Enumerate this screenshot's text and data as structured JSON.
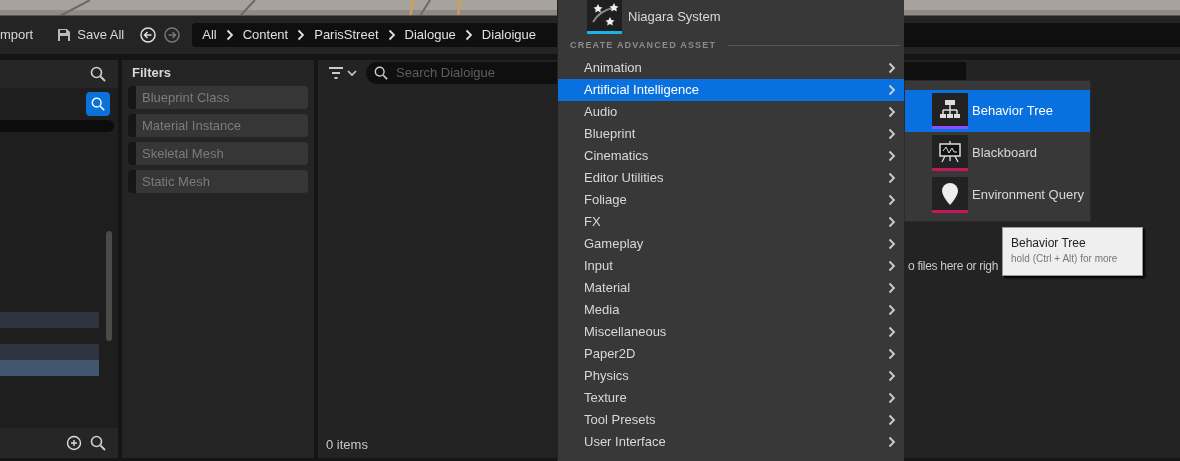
{
  "toolbar": {
    "import_label": "mport",
    "save_all": "Save All",
    "breadcrumbs": [
      "All",
      "Content",
      "ParisStreet",
      "Dialogue",
      "Dialoigue"
    ]
  },
  "sources": {
    "rows": [
      {
        "selected": false
      },
      {
        "selected": false
      },
      {
        "selected": true
      }
    ]
  },
  "filters": {
    "title": "Filters",
    "items": [
      "Blueprint Class",
      "Material Instance",
      "Skeletal Mesh",
      "Static Mesh"
    ]
  },
  "content": {
    "search": {
      "placeholder": "Search Dialoigue"
    },
    "drop_hint": "o files here or righ",
    "item_count": "0 items"
  },
  "menu": {
    "top_item": "Niagara System",
    "section": "CREATE ADVANCED ASSET",
    "items": [
      {
        "label": "Animation",
        "selected": false
      },
      {
        "label": "Artificial Intelligence",
        "selected": true
      },
      {
        "label": "Audio",
        "selected": false
      },
      {
        "label": "Blueprint",
        "selected": false
      },
      {
        "label": "Cinematics",
        "selected": false
      },
      {
        "label": "Editor Utilities",
        "selected": false
      },
      {
        "label": "Foliage",
        "selected": false
      },
      {
        "label": "FX",
        "selected": false
      },
      {
        "label": "Gameplay",
        "selected": false
      },
      {
        "label": "Input",
        "selected": false
      },
      {
        "label": "Material",
        "selected": false
      },
      {
        "label": "Media",
        "selected": false
      },
      {
        "label": "Miscellaneous",
        "selected": false
      },
      {
        "label": "Paper2D",
        "selected": false
      },
      {
        "label": "Physics",
        "selected": false
      },
      {
        "label": "Texture",
        "selected": false
      },
      {
        "label": "Tool Presets",
        "selected": false
      },
      {
        "label": "User Interface",
        "selected": false
      }
    ]
  },
  "submenu": {
    "items": [
      {
        "label": "Behavior Tree",
        "kind": "tree",
        "selected": true,
        "color": "#8a4dff"
      },
      {
        "label": "Blackboard",
        "kind": "board",
        "selected": false,
        "color": "#c2185b"
      },
      {
        "label": "Environment Query",
        "kind": "pin",
        "selected": false,
        "color": "#c2185b"
      }
    ]
  },
  "tooltip": {
    "title": "Behavior Tree",
    "hint": "hold (Ctrl + Alt) for more"
  }
}
